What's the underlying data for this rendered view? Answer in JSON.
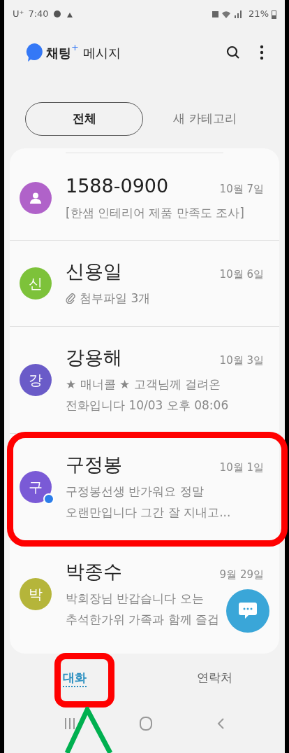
{
  "status_bar": {
    "carrier": "U⁺",
    "time": "7:40",
    "battery": "21%"
  },
  "header": {
    "brand": "채팅",
    "brand_mark": "+",
    "title": "메시지"
  },
  "filters": [
    {
      "label": "전체",
      "selected": true
    },
    {
      "label": "새 카테고리",
      "selected": false
    }
  ],
  "conversations": [
    {
      "name": "1588-0900",
      "date": "10월 7일",
      "avatar": {
        "kind": "icon",
        "color": "#b062c9"
      },
      "attachment": false,
      "unread": false,
      "preview_lines": [
        "[한샘 인테리어 제품 만족도 조사]"
      ]
    },
    {
      "name": "신용일",
      "date": "10월 6일",
      "avatar": {
        "kind": "letter",
        "text": "신",
        "color": "#7dc23a"
      },
      "attachment": true,
      "unread": false,
      "preview_lines": [
        "첨부파일 3개"
      ]
    },
    {
      "name": "강용해",
      "date": "10월 3일",
      "avatar": {
        "kind": "letter",
        "text": "강",
        "color": "#6a5bc8"
      },
      "attachment": false,
      "unread": false,
      "preview_lines": [
        "★ 매너콜 ★ 고객님께 걸려온",
        "전화입니다 10/03 오후 08:06"
      ]
    },
    {
      "name": "구정봉",
      "date": "10월 1일",
      "avatar": {
        "kind": "letter",
        "text": "구",
        "color": "#7a5ad6"
      },
      "attachment": false,
      "unread": true,
      "preview_lines": [
        "구정봉선생 반가워요 정말",
        "오랜만입니다 그간 잘 지내고..."
      ]
    },
    {
      "name": "박종수",
      "date": "9월 29일",
      "avatar": {
        "kind": "letter",
        "text": "박",
        "color": "#b5b53a"
      },
      "attachment": false,
      "unread": false,
      "preview_lines": [
        "박회장님 반갑습니다 오는",
        "추석한가위 가족과 함께 즐겁"
      ]
    }
  ],
  "bottom_tabs": [
    {
      "label": "대화",
      "selected": true
    },
    {
      "label": "연락처",
      "selected": false
    }
  ]
}
